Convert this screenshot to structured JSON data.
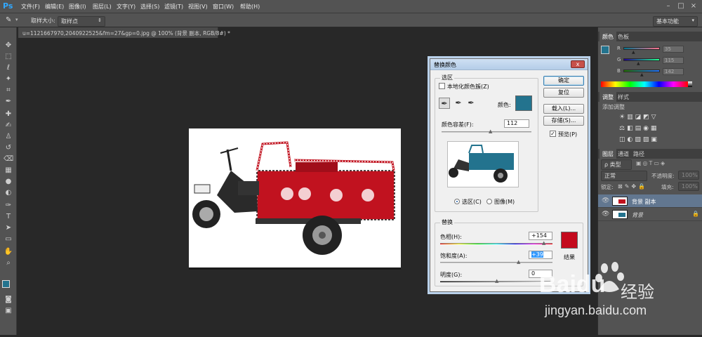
{
  "app": {
    "logo": "Ps"
  },
  "menu": [
    "文件(F)",
    "编辑(E)",
    "图像(I)",
    "图层(L)",
    "文字(Y)",
    "选择(S)",
    "滤镜(T)",
    "视图(V)",
    "窗口(W)",
    "帮助(H)"
  ],
  "options": {
    "sample_label": "取样大小:",
    "sample_value": "取样点",
    "workspace": "基本功能"
  },
  "document": {
    "tab_title": "u=1121667970,2040922525&fm=27&gp=0.jpg @ 100% (背景 副本, RGB/8#) *",
    "close": "×"
  },
  "panels": {
    "color_tabs": [
      "颜色",
      "色板"
    ],
    "rgb": [
      {
        "ch": "R",
        "val": "35"
      },
      {
        "ch": "G",
        "val": "115"
      },
      {
        "ch": "B",
        "val": "142"
      }
    ],
    "fg_color": "#23738e",
    "adjust_tabs": [
      "调整",
      "样式"
    ],
    "adjust_hint": "添加调整",
    "layer_tabs": [
      "图层",
      "通道",
      "路径"
    ],
    "kind": "ρ 类型",
    "blend": "正常",
    "opacity_label": "不透明度:",
    "opacity": "100%",
    "lock_label": "锁定:",
    "fill_label": "填充:",
    "fill": "100%",
    "layers": [
      {
        "name": "背景 副本"
      },
      {
        "name": "背景"
      }
    ]
  },
  "dialog": {
    "title": "替换颜色",
    "close": "x",
    "selection_group": "选区",
    "localized": "本地化颜色簇(Z)",
    "color_label": "颜色:",
    "selection_color": "#23738e",
    "fuzziness_label": "颜色容差(F):",
    "fuzziness": "112",
    "radio_selection": "选区(C)",
    "radio_image": "图像(M)",
    "btn_ok": "确定",
    "btn_reset": "复位",
    "btn_load": "载入(L)...",
    "btn_save": "存储(S)...",
    "preview": "预览(P)",
    "replace_group": "替换",
    "hue_label": "色相(H):",
    "hue": "+154",
    "sat_label": "饱和度(A):",
    "sat": "+39",
    "light_label": "明度(G):",
    "light": "0",
    "result_label": "结果",
    "result_color": "#c40a1d"
  },
  "watermark": {
    "brand": "Baidu",
    "brand_cn": "经验",
    "url": "jingyan.baidu.com"
  }
}
